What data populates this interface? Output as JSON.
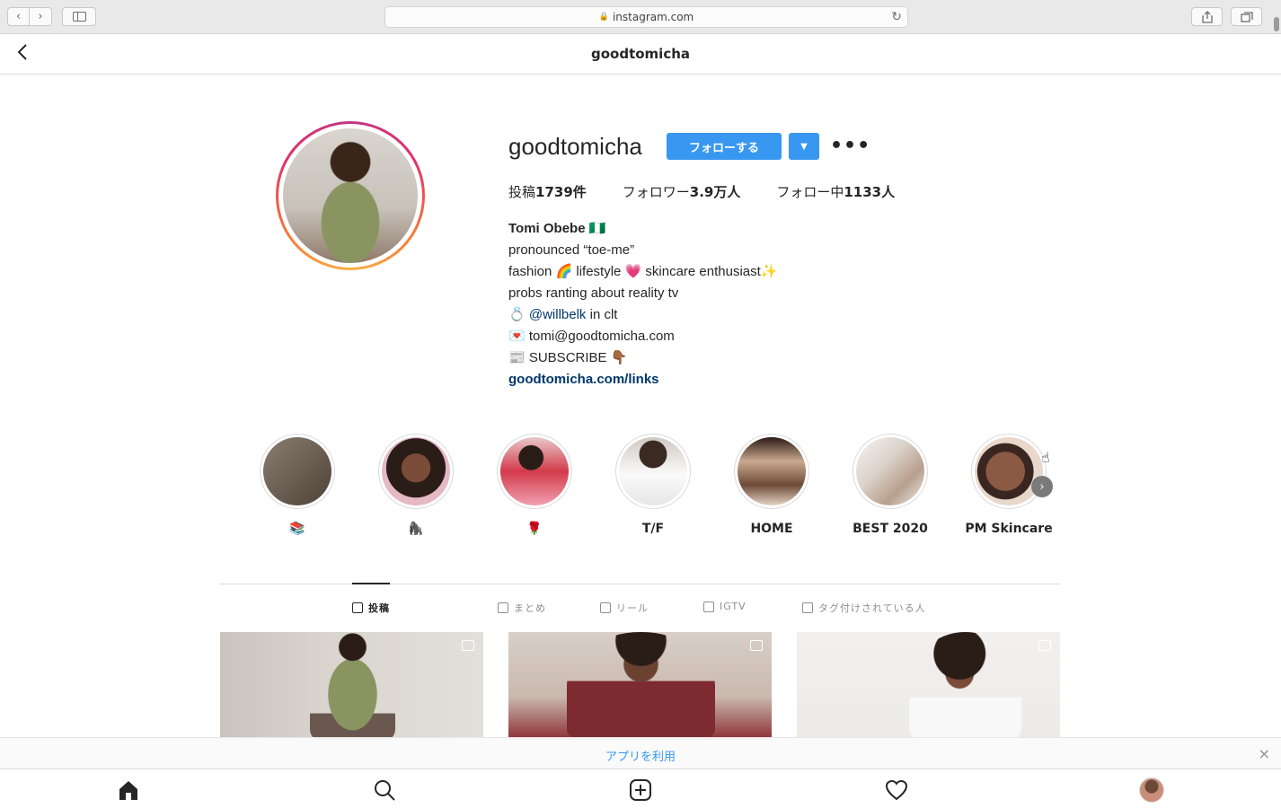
{
  "browser": {
    "address": "instagram.com",
    "lock_icon": "lock-icon",
    "reload_icon": "reload-icon"
  },
  "header": {
    "title": "goodtomicha"
  },
  "profile": {
    "username": "goodtomicha",
    "follow_label": "フォローする",
    "stats": {
      "posts_prefix": "投稿",
      "posts_value": "1739件",
      "followers_prefix": "フォロワー",
      "followers_value": "3.9万人",
      "following_prefix": "フォロー中",
      "following_value": "1133人"
    },
    "bio": {
      "name": "Tomi Obebe",
      "name_flag": "🇳🇬",
      "line1": "pronounced “toe-me”",
      "line2_a": "fashion 🌈 lifestyle 💗 skincare enthusiast✨",
      "line3": "probs ranting about reality tv",
      "line4_prefix": "💍",
      "line4_mention": "@willbelk",
      "line4_suffix": "in clt",
      "line5": "💌 tomi@goodtomicha.com",
      "line6": "📰 SUBSCRIBE 👇🏾",
      "link": "goodtomicha.com/links"
    }
  },
  "highlights": [
    {
      "label": "📚",
      "color": "#6e6257"
    },
    {
      "label": "🦍",
      "color": "#3a2a22"
    },
    {
      "label": "🌹",
      "color": "#d44a5a"
    },
    {
      "label": "T/F",
      "color": "#8c8c8c"
    },
    {
      "label": "HOME",
      "color": "#7a4f3a"
    },
    {
      "label": "BEST 2020",
      "color": "#d9d6d2"
    },
    {
      "label": "PM Skincare",
      "color": "#8a5a44"
    }
  ],
  "tabs": [
    {
      "label": "投稿",
      "active": true
    },
    {
      "label": "まとめ",
      "active": false
    },
    {
      "label": "リール",
      "active": false
    },
    {
      "label": "IGTV",
      "active": false
    },
    {
      "label": "タグ付けされている人",
      "active": false
    }
  ],
  "banner": {
    "label": "アプリを利用",
    "close": "×"
  },
  "bottom_nav": [
    "home-icon",
    "search-icon",
    "new-post-icon",
    "activity-icon",
    "profile-avatar"
  ]
}
